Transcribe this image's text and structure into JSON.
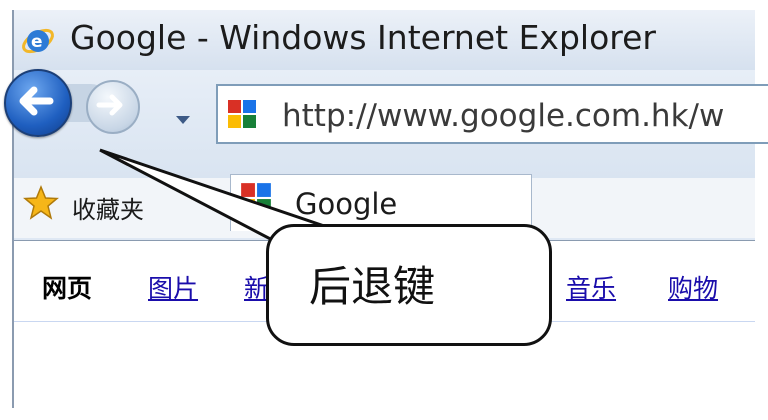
{
  "window": {
    "title": "Google - Windows Internet Explorer"
  },
  "navbar": {
    "address": "http://www.google.com.hk/w"
  },
  "favorites": {
    "label": "收藏夹"
  },
  "tab": {
    "label": "Google"
  },
  "page_nav": {
    "links": [
      {
        "label": "网页",
        "active": true
      },
      {
        "label": "图片",
        "active": false
      },
      {
        "label": "新",
        "active": false
      },
      {
        "label": "音乐",
        "active": false
      },
      {
        "label": "购物",
        "active": false
      }
    ]
  },
  "annotation": {
    "callout_text": "后退键"
  },
  "icons": {
    "browser": "ie-logo-icon",
    "back": "back-arrow-icon",
    "forward": "forward-arrow-icon",
    "dropdown": "chevron-down-icon",
    "site": "google-favicon-icon",
    "favorites": "star-icon"
  },
  "colors": {
    "link": "#1a0dab",
    "back_button": "#1f5fc0",
    "titlebar": "#dfe8f4"
  }
}
